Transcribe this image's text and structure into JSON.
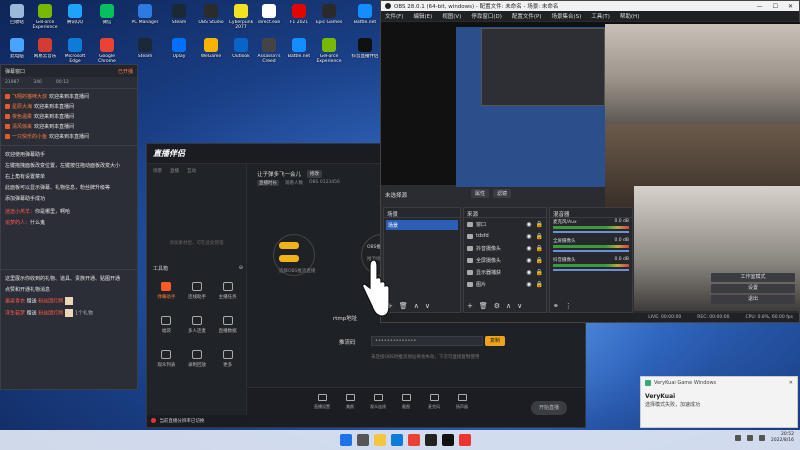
{
  "desktop": {
    "icons": [
      {
        "label": "回收站",
        "color": "#9bb8d9"
      },
      {
        "label": "GeForce Experience",
        "color": "#76b900"
      },
      {
        "label": "腾讯QQ",
        "color": "#1fa3ff"
      },
      {
        "label": "微信",
        "color": "#07c160"
      },
      {
        "label": "PC Manager",
        "color": "#2d7be0"
      },
      {
        "label": "Steam",
        "color": "#1b2838"
      },
      {
        "label": "OBS Studio",
        "color": "#2b2b2b"
      },
      {
        "label": "Cyberpunk 2077",
        "color": "#f2e21f"
      },
      {
        "label": "direct.exe",
        "color": "#ffffff"
      },
      {
        "label": "F1 2021",
        "color": "#e10600"
      },
      {
        "label": "Epic Games",
        "color": "#2a2a2a"
      },
      {
        "label": "Battle.net",
        "color": "#148eff"
      },
      {
        "label": "此电脑",
        "color": "#4aa3ff"
      },
      {
        "label": "网易云音乐",
        "color": "#d43c33"
      },
      {
        "label": "Microsoft Edge",
        "color": "#0f7bd8"
      },
      {
        "label": "Google Chrome",
        "color": "#ea4335"
      },
      {
        "label": "Steam",
        "color": "#1b2838"
      },
      {
        "label": "Uplay",
        "color": "#0070ff"
      },
      {
        "label": "WeGame",
        "color": "#f6b400"
      },
      {
        "label": "Outlook",
        "color": "#0a64c8"
      },
      {
        "label": "Assassin's Creed",
        "color": "#444444"
      },
      {
        "label": "Battle.net",
        "color": "#148eff"
      },
      {
        "label": "GeForce Experience",
        "color": "#76b900"
      },
      {
        "label": "抖音直播伴侣",
        "color": "#111111"
      }
    ]
  },
  "chat": {
    "header_title": "弹幕窗口",
    "header_right": "已开播",
    "stats": [
      "21987",
      "346",
      "00:12"
    ],
    "messages": [
      {
        "user": "飞翔的猫咪大叔",
        "text": "欢迎来到本直播间"
      },
      {
        "user": "星辰大海",
        "text": "欢迎来到本直播间"
      },
      {
        "user": "夜色温柔",
        "text": "欢迎来到本直播间"
      },
      {
        "user": "清风徐来",
        "text": "欢迎来到本直播间"
      },
      {
        "user": "一只快乐的小鱼",
        "text": "欢迎来到本直播间"
      }
    ],
    "system_lines": [
      "欢迎使用弹幕助手",
      "左键拖拽面板改变位置，左键按住拖动面板改变大小",
      "右上角有设置菜单",
      "此面板可以显示弹幕、礼物信息，粉丝牌升级等",
      "添加弹幕助手成功"
    ],
    "user_lines": [
      {
        "user": "迷途小羔羊：",
        "text": "你是哪里，啊哈"
      },
      {
        "user": "追梦的人：",
        "text": "什么鬼"
      }
    ],
    "gift_header": "这里展示你收到的礼物、道具、贵族开通、贴图开通",
    "gift_sub": "点赞和开通礼物消息",
    "gifts": [
      {
        "user": "墨染青衣",
        "action": "赠送",
        "item": "粉丝团灯牌"
      },
      {
        "user": "浮生若梦",
        "action": "赠送",
        "item": "粉丝团灯牌",
        "count": "1个礼物"
      }
    ]
  },
  "companion": {
    "logo": "直播伴侣",
    "side_tabs": [
      "场景",
      "直播",
      "互动"
    ],
    "side_placeholder": "添加素材后，可在此处管理",
    "tools_title": "工具箱",
    "tools": [
      {
        "label": "弹幕助手",
        "hot": true
      },
      {
        "label": "连线助手",
        "hot": false
      },
      {
        "label": "主播任务",
        "hot": false
      },
      {
        "label": "福袋",
        "hot": false
      },
      {
        "label": "多人连麦",
        "hot": false
      },
      {
        "label": "直播数据",
        "hot": false
      },
      {
        "label": "观众列表",
        "hot": false
      },
      {
        "label": "录制回放",
        "hot": false
      },
      {
        "label": "更多",
        "hot": false
      }
    ],
    "stream_title": "让子弹多飞一会儿",
    "stream_title_pill": "修改",
    "sub_items": [
      "直播时长",
      "观看人数",
      "OBS 0123456"
    ],
    "node1_caption": "选择OBS推流直播",
    "node2_caption": "OBS推流",
    "node2_sub": "推流地址",
    "rtmp_label": "rtmp地址",
    "key_label": "推流码",
    "key_value": "••••••••••••••",
    "copy_button": "复制",
    "hint": "未连接OBS时推流地址将会失效，下次可直接复制使用",
    "bottom_items": [
      "直播设置",
      "美颜",
      "观众连线",
      "截图",
      "麦克风",
      "扬声器"
    ],
    "start_button": "开始直播",
    "notice": "当前直播分辨率已切换"
  },
  "obs": {
    "title": "OBS 28.0.1 (64-bit, windows) - 配置文件: 未命名 - 场景: 未命名",
    "menu": [
      "文件(F)",
      "编辑(E)",
      "视图(V)",
      "停靠窗口(D)",
      "配置文件(P)",
      "场景集合(S)",
      "工具(T)",
      "帮助(H)"
    ],
    "no_source": "未选择源",
    "props_buttons": [
      "属性",
      "滤镜"
    ],
    "scenes_title": "场景",
    "scenes": [
      "场景"
    ],
    "sources_title": "来源",
    "sources": [
      "窗口",
      "tdsfd",
      "抖音摄像头",
      "全屏摄像头",
      "显示器捕获",
      "图片"
    ],
    "mixer_title": "混音器",
    "mixer": [
      {
        "name": "麦克风/Aux",
        "db": "0.0 dB"
      },
      {
        "name": "全屏摄像头",
        "db": "0.0 dB"
      },
      {
        "name": "抖音摄像头",
        "db": "0.0 dB"
      }
    ],
    "controls": [
      "工作室模式",
      "设置",
      "退出"
    ],
    "status": [
      "LIVE: 00:00:00",
      "REC: 00:00:00",
      "CPU: 0.8%, 60.00 fps"
    ]
  },
  "toast": {
    "app": "VeryKuai Game Windows",
    "title": "VeryKuai",
    "message": "选择模式失败，加速成功"
  },
  "taskbar": {
    "time": "20:52",
    "date": "2022/8/16"
  }
}
